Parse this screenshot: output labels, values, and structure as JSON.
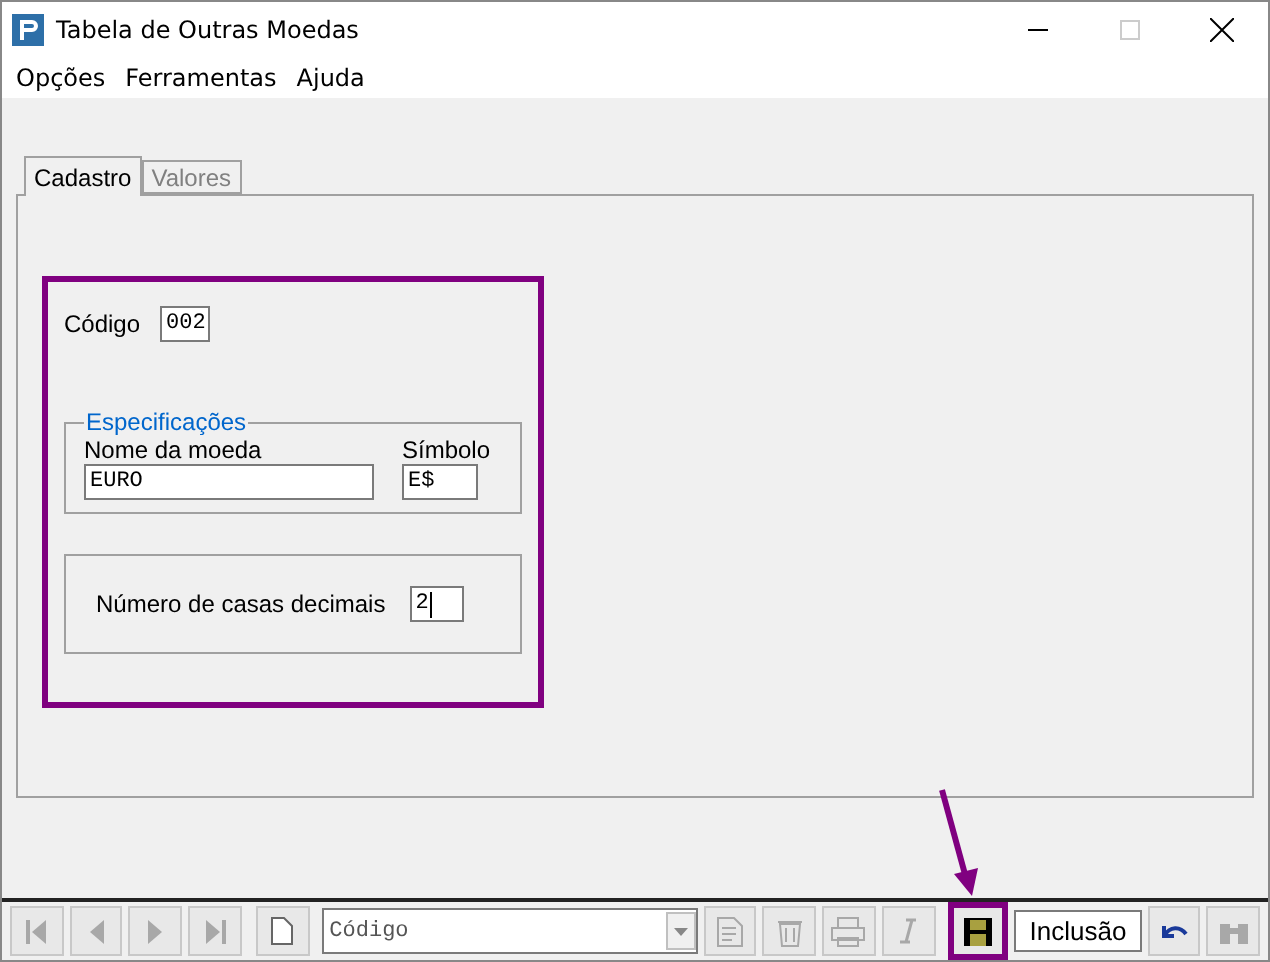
{
  "window": {
    "title": "Tabela de Outras Moedas"
  },
  "menu": [
    "Opções",
    "Ferramentas",
    "Ajuda"
  ],
  "tabs": [
    {
      "label": "Cadastro",
      "selected": true
    },
    {
      "label": "Valores",
      "selected": false
    }
  ],
  "form": {
    "codigo_label": "Código",
    "codigo": "002",
    "group_title": "Especificações",
    "nome_label": "Nome da moeda",
    "nome": "EURO",
    "simbolo_label": "Símbolo",
    "simbolo": "E$",
    "decimais_label": "Número de casas decimais",
    "decimais": "2"
  },
  "toolbar": {
    "nav": [
      {
        "kind": "first",
        "disabled": true
      },
      {
        "kind": "prev",
        "disabled": true
      },
      {
        "kind": "next",
        "disabled": true
      },
      {
        "kind": "last",
        "disabled": true
      }
    ],
    "search_field": {
      "value": "Código"
    },
    "actions": [
      {
        "kind": "edit",
        "disabled": true
      },
      {
        "kind": "delete",
        "disabled": true
      },
      {
        "kind": "print",
        "disabled": true
      },
      {
        "kind": "italic",
        "disabled": true
      }
    ],
    "save": {
      "highlighted": true
    },
    "status": "Inclusão"
  }
}
